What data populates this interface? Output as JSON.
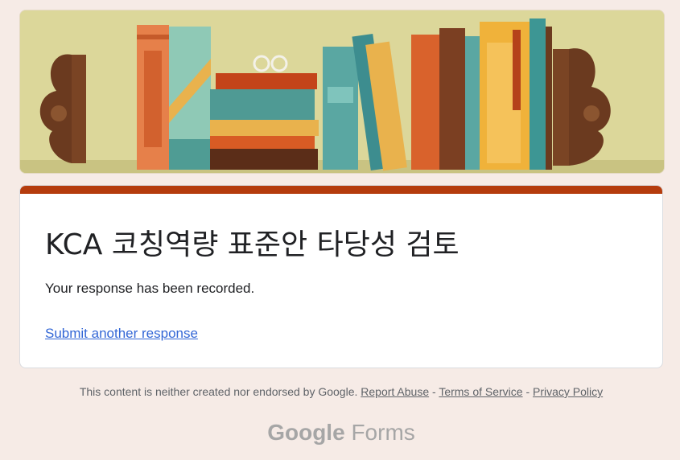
{
  "banner": {
    "alt": "bookshelf-illustration"
  },
  "form": {
    "title": "KCA 코칭역량 표준안 타당성 검토",
    "confirmation": "Your response has been recorded.",
    "another_response_link": "Submit another response"
  },
  "footer": {
    "disclaimer": "This content is neither created nor endorsed by Google.",
    "report_abuse": "Report Abuse",
    "sep1": "-",
    "terms": "Terms of Service",
    "sep2": "-",
    "privacy": "Privacy Policy"
  },
  "brand": {
    "google": "Google",
    "forms": "Forms"
  },
  "colors": {
    "accent": "#b53c0d",
    "link": "#3367d6",
    "background": "#f6ebe6"
  }
}
